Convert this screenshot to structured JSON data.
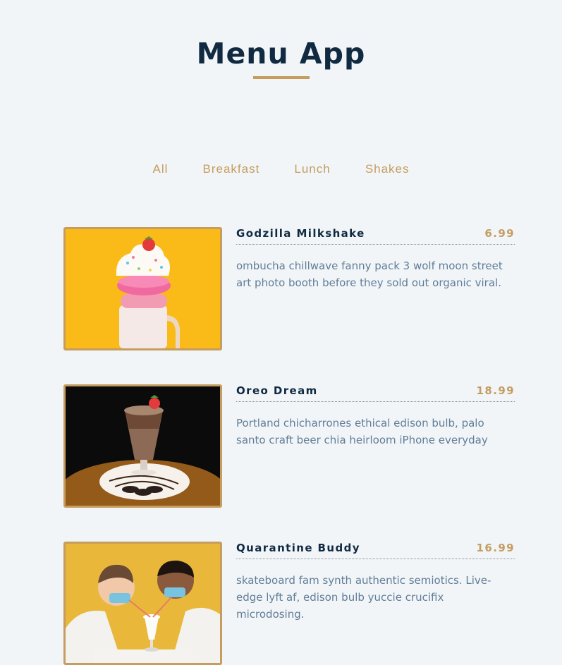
{
  "app": {
    "title": "Menu App"
  },
  "filters": [
    "All",
    "Breakfast",
    "Lunch",
    "Shakes"
  ],
  "menu": [
    {
      "name": "Godzilla Milkshake",
      "price": "6.99",
      "desc": "ombucha chillwave fanny pack 3 wolf moon street art photo booth before they sold out organic viral.",
      "photo": "milkshake-with-donut-photo"
    },
    {
      "name": "Oreo Dream",
      "price": "18.99",
      "desc": "Portland chicharrones ethical edison bulb, palo santo craft beer chia heirloom iPhone everyday",
      "photo": "oreo-shake-photo"
    },
    {
      "name": "Quarantine Buddy",
      "price": "16.99",
      "desc": "skateboard fam synth authentic semiotics. Live-edge lyft af, edison bulb yuccie crucifix microdosing.",
      "photo": "couple-sharing-shake-photo"
    }
  ],
  "colors": {
    "accent": "#c59d5f",
    "heading": "#102a42",
    "text": "#617d98",
    "background": "#f1f5f8"
  }
}
